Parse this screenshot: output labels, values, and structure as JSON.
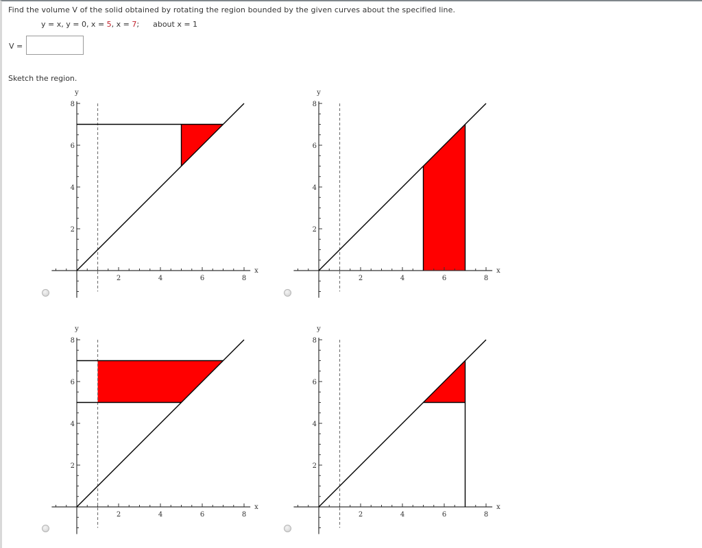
{
  "question": {
    "prompt": "Find the volume V of the solid obtained by rotating the region bounded by the given curves about the specified line.",
    "equation_parts": [
      {
        "text": "y = x, y = 0, x = ",
        "color": null
      },
      {
        "text": "5",
        "color": "#c0202a"
      },
      {
        "text": ", x = ",
        "color": null
      },
      {
        "text": "7",
        "color": "#c0202a"
      },
      {
        "text": ";",
        "color": null
      }
    ],
    "axis_of_rotation": "about x = 1",
    "answer_label": "V =",
    "answer_value": "",
    "sketch_prompt": "Sketch the region."
  },
  "options": [
    {
      "id": "option-a",
      "selected": false
    },
    {
      "id": "option-b",
      "selected": false
    },
    {
      "id": "option-c",
      "selected": false
    },
    {
      "id": "option-d",
      "selected": false
    }
  ],
  "colors": {
    "fill": "#ff0000",
    "curve": "#000000",
    "axis": "#333333",
    "dashed": "#777777"
  },
  "chart_data": [
    {
      "type": "area",
      "title": "",
      "xlabel": "x",
      "ylabel": "y",
      "xlim": [
        -1.2,
        8.3
      ],
      "ylim": [
        -1.3,
        8.1
      ],
      "xticks": [
        2,
        4,
        6,
        8
      ],
      "yticks": [
        2,
        4,
        6,
        8
      ],
      "dashed_line": {
        "x": 1,
        "label": "x = 1"
      },
      "curves": [
        {
          "name": "y = x",
          "points": [
            [
              0,
              0
            ],
            [
              8,
              8
            ]
          ]
        },
        {
          "name": "y = 7 segment",
          "points": [
            [
              0,
              7
            ],
            [
              7,
              7
            ]
          ]
        },
        {
          "name": "x = 5 segment",
          "points": [
            [
              5,
              5
            ],
            [
              5,
              7
            ]
          ]
        }
      ],
      "shaded_region": [
        [
          5,
          5
        ],
        [
          7,
          7
        ],
        [
          5,
          7
        ]
      ]
    },
    {
      "type": "area",
      "title": "",
      "xlabel": "x",
      "ylabel": "y",
      "xlim": [
        -1.2,
        8.3
      ],
      "ylim": [
        -1.3,
        8.1
      ],
      "xticks": [
        2,
        4,
        6,
        8
      ],
      "yticks": [
        2,
        4,
        6,
        8
      ],
      "dashed_line": {
        "x": 1,
        "label": "x = 1"
      },
      "curves": [
        {
          "name": "y = x",
          "points": [
            [
              0,
              0
            ],
            [
              8,
              8
            ]
          ]
        },
        {
          "name": "x = 5 segment",
          "points": [
            [
              5,
              0
            ],
            [
              5,
              5
            ]
          ]
        },
        {
          "name": "x = 7 segment",
          "points": [
            [
              7,
              0
            ],
            [
              7,
              7
            ]
          ]
        }
      ],
      "shaded_region": [
        [
          5,
          0
        ],
        [
          7,
          0
        ],
        [
          7,
          7
        ],
        [
          5,
          5
        ]
      ]
    },
    {
      "type": "area",
      "title": "",
      "xlabel": "x",
      "ylabel": "y",
      "xlim": [
        -1.2,
        8.3
      ],
      "ylim": [
        -1.3,
        8.1
      ],
      "xticks": [
        2,
        4,
        6,
        8
      ],
      "yticks": [
        2,
        4,
        6,
        8
      ],
      "dashed_line": {
        "x": 1,
        "label": "x = 1"
      },
      "curves": [
        {
          "name": "y = x",
          "points": [
            [
              0,
              0
            ],
            [
              8,
              8
            ]
          ]
        },
        {
          "name": "y = 7 segment",
          "points": [
            [
              0,
              7
            ],
            [
              7,
              7
            ]
          ]
        },
        {
          "name": "y = 5 segment",
          "points": [
            [
              0,
              5
            ],
            [
              5,
              5
            ]
          ]
        }
      ],
      "shaded_region": [
        [
          1,
          5
        ],
        [
          5,
          5
        ],
        [
          7,
          7
        ],
        [
          1,
          7
        ]
      ]
    },
    {
      "type": "area",
      "title": "",
      "xlabel": "x",
      "ylabel": "y",
      "xlim": [
        -1.2,
        8.3
      ],
      "ylim": [
        -1.3,
        8.1
      ],
      "xticks": [
        2,
        4,
        6,
        8
      ],
      "yticks": [
        2,
        4,
        6,
        8
      ],
      "dashed_line": {
        "x": 1,
        "label": "x = 1"
      },
      "curves": [
        {
          "name": "y = x",
          "points": [
            [
              0,
              0
            ],
            [
              8,
              8
            ]
          ]
        },
        {
          "name": "y = 5 segment",
          "points": [
            [
              5,
              5
            ],
            [
              7,
              5
            ]
          ]
        },
        {
          "name": "x = 7 segment",
          "points": [
            [
              7,
              0
            ],
            [
              7,
              7
            ]
          ]
        }
      ],
      "shaded_region": [
        [
          5,
          5
        ],
        [
          7,
          5
        ],
        [
          7,
          7
        ]
      ]
    }
  ]
}
